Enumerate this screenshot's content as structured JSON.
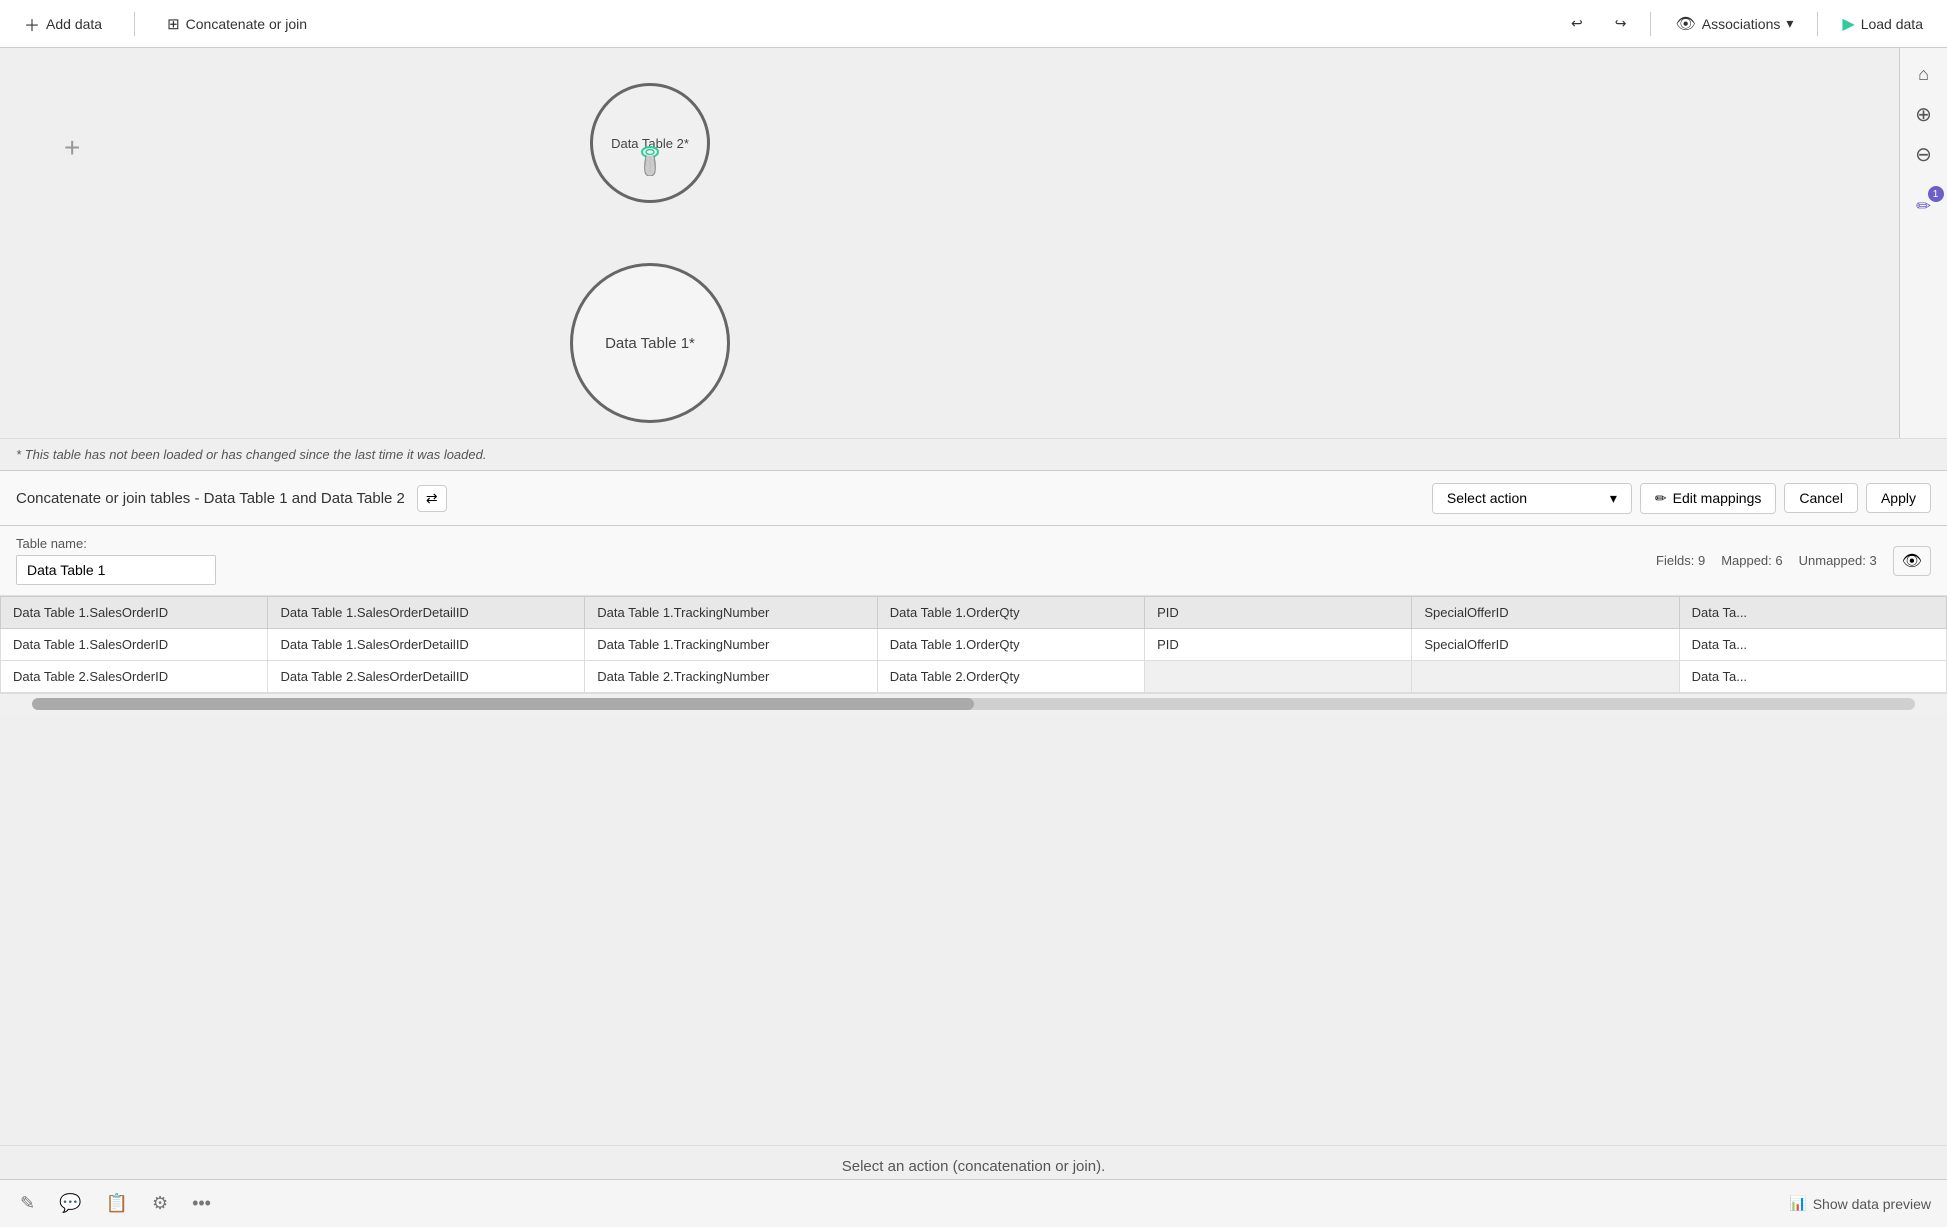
{
  "toolbar": {
    "add_data_label": "Add data",
    "concatenate_join_label": "Concatenate or join",
    "undo_icon": "↩",
    "redo_icon": "↪",
    "associations_label": "Associations",
    "associations_icon": "👁",
    "associations_chevron": "▾",
    "load_data_label": "Load data",
    "load_data_icon": "▶"
  },
  "right_tools": {
    "home_icon": "⌂",
    "zoom_in_icon": "⊕",
    "zoom_out_icon": "⊖",
    "edit_icon": "✏",
    "badge_count": "1"
  },
  "canvas": {
    "plus_icon": "+",
    "table2_label": "Data Table 2*",
    "table1_label": "Data Table 1*",
    "cursor_color": "#2ecc9a"
  },
  "warning": {
    "text": "* This table has not been loaded or has changed since the last time it was loaded."
  },
  "join_panel": {
    "title": "Concatenate or join tables - Data Table 1 and Data Table 2",
    "swap_icon": "⇄",
    "select_action_label": "Select action",
    "select_action_chevron": "▾",
    "edit_mappings_icon": "✏",
    "edit_mappings_label": "Edit mappings",
    "cancel_label": "Cancel",
    "apply_label": "Apply"
  },
  "table_section": {
    "name_label": "Table name:",
    "name_value": "Data Table 1",
    "fields_label": "Fields: 9",
    "mapped_label": "Mapped: 6",
    "unmapped_label": "Unmapped: 3",
    "eye_icon": "👁"
  },
  "data_grid": {
    "columns": [
      "Data Table 1.SalesOrderID",
      "Data Table 1.SalesOrderDetailID",
      "Data Table 1.TrackingNumber",
      "Data Table 1.OrderQty",
      "PID",
      "SpecialOfferID",
      "Data Ta..."
    ],
    "rows": [
      {
        "col0": "Data Table 1.SalesOrderID",
        "col1": "Data Table 1.SalesOrderDetailID",
        "col2": "Data Table 1.TrackingNumber",
        "col3": "Data Table 1.OrderQty",
        "col4": "PID",
        "col5": "SpecialOfferID",
        "col6": "Data Ta...",
        "empty4": false,
        "empty5": false
      },
      {
        "col0": "Data Table 2.SalesOrderID",
        "col1": "Data Table 2.SalesOrderDetailID",
        "col2": "Data Table 2.TrackingNumber",
        "col3": "Data Table 2.OrderQty",
        "col4": "",
        "col5": "",
        "col6": "Data Ta...",
        "empty4": true,
        "empty5": true
      }
    ]
  },
  "bottom": {
    "info_text": "Select an action (concatenation or join).",
    "icon1": "✎",
    "icon2": "💬",
    "icon3": "📋",
    "icon4": "⚙",
    "icon5": "•••",
    "show_preview_icon": "📊",
    "show_preview_label": "Show data preview"
  }
}
